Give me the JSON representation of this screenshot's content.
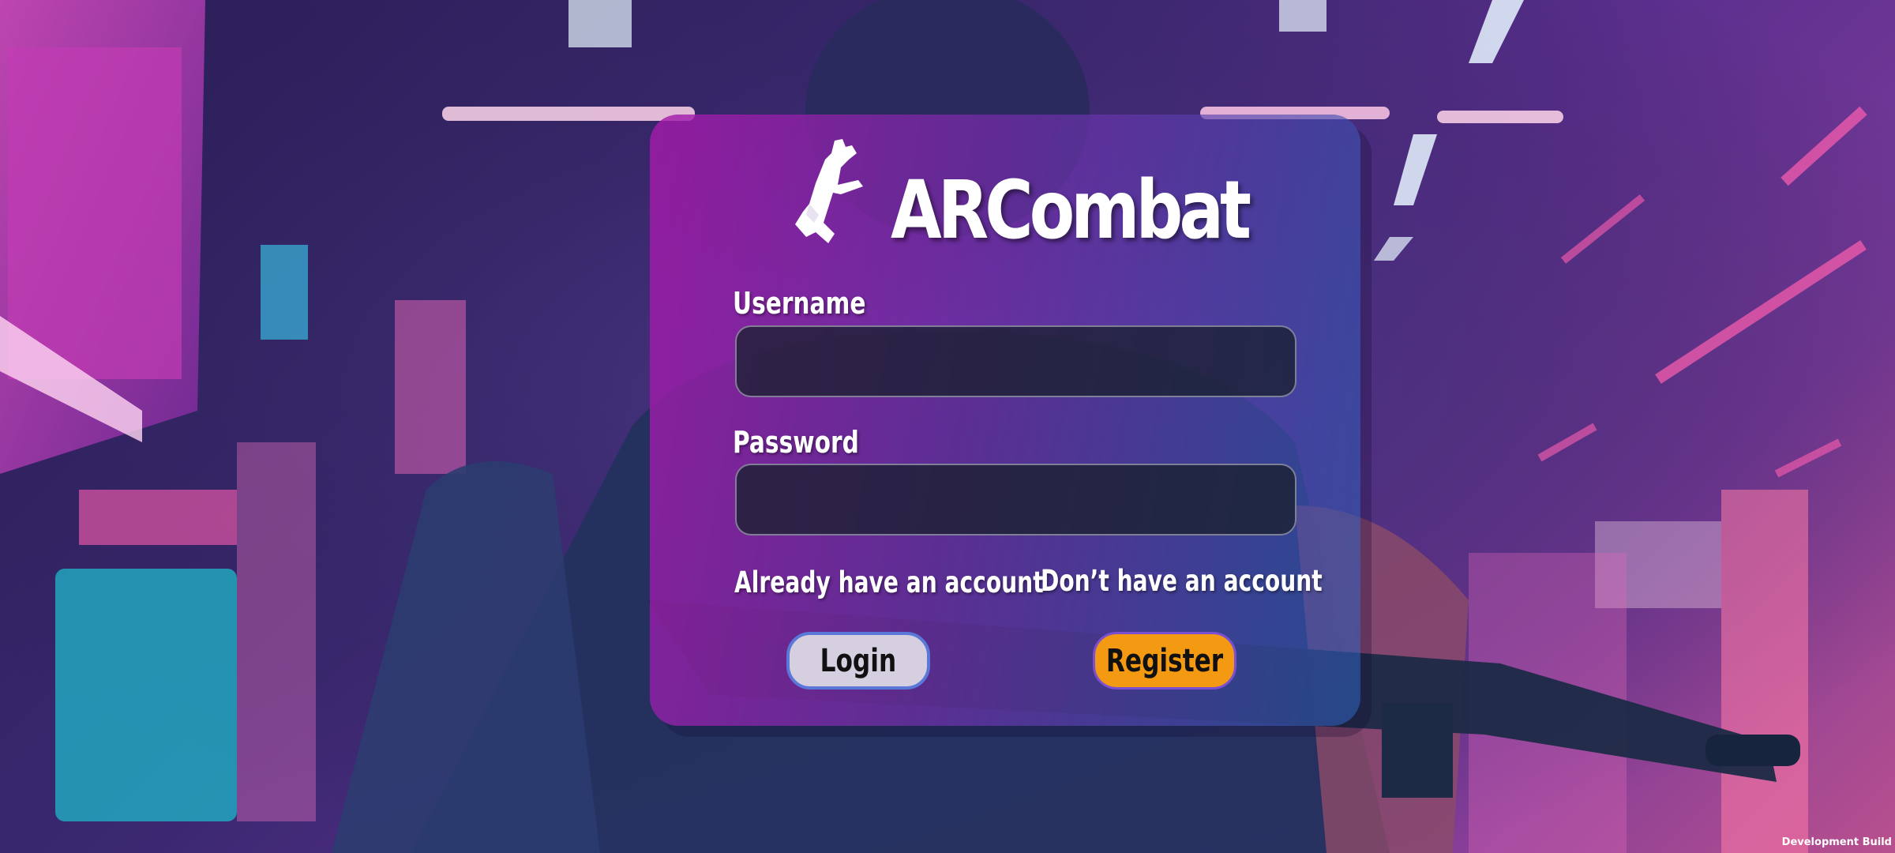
{
  "app": {
    "title": "ARCombat",
    "logo_icon": "pistol-icon"
  },
  "form": {
    "username_label": "Username",
    "username_value": "",
    "password_label": "Password",
    "password_value": ""
  },
  "actions": {
    "login_hint": "Already have an account",
    "register_hint": "Don’t have an account",
    "login_label": "Login",
    "register_label": "Register"
  },
  "footer": {
    "build_label": "Development Build"
  },
  "colors": {
    "panel_start": "#a51aaa",
    "panel_end": "#285aaf",
    "register_button": "#f49a12",
    "login_button": "#d6cfe0"
  }
}
